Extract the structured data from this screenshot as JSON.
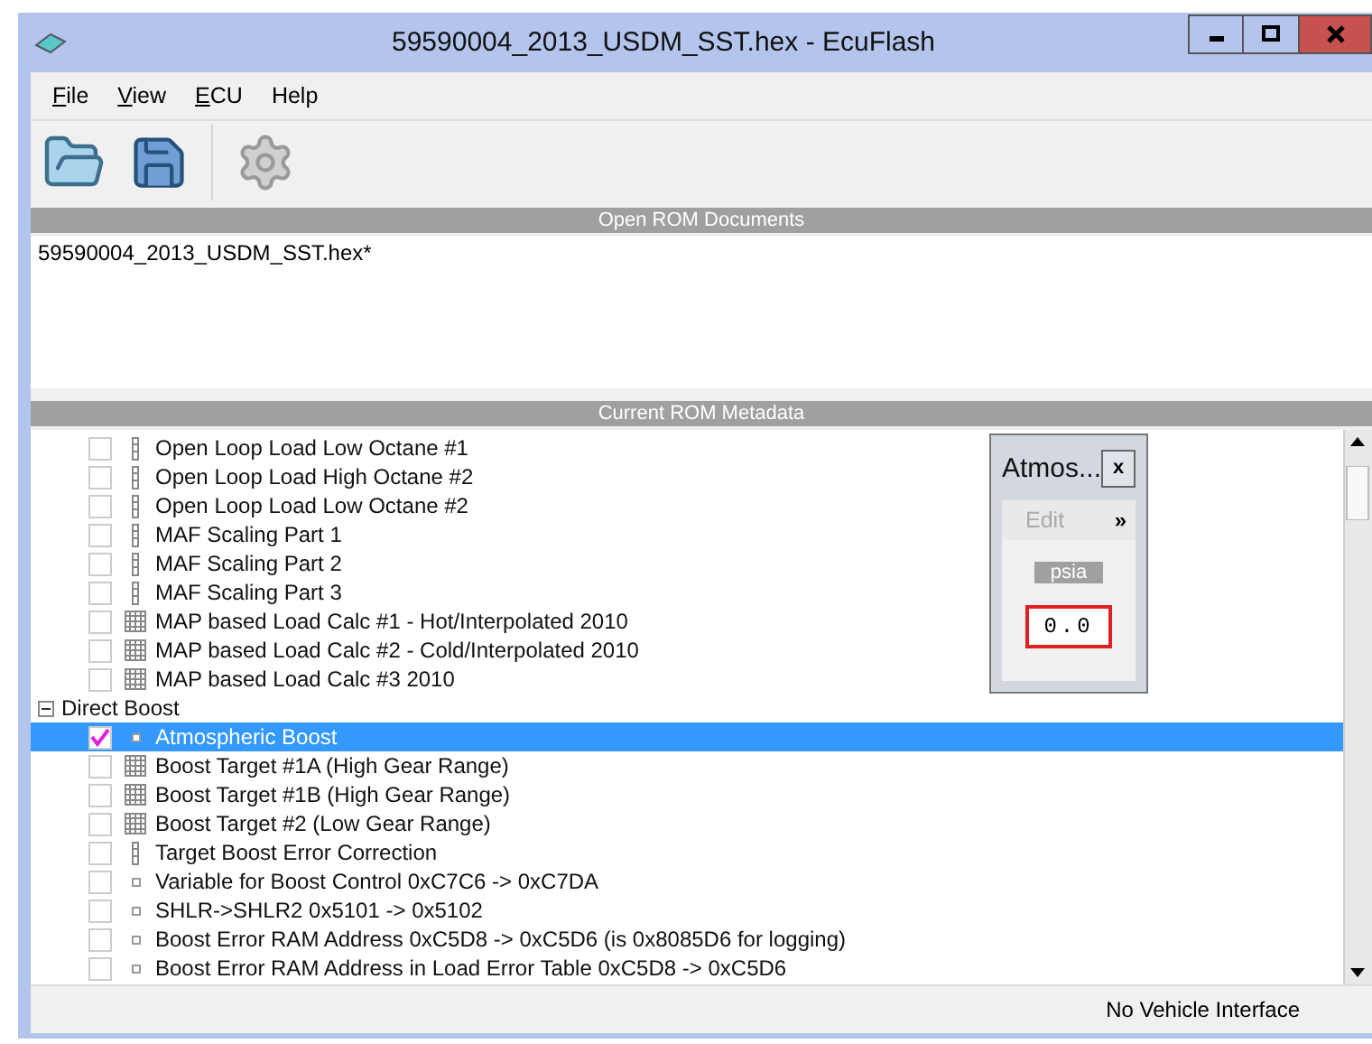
{
  "window": {
    "title": "59590004_2013_USDM_SST.hex - EcuFlash"
  },
  "menu": [
    {
      "label": "File",
      "mnemonic": true
    },
    {
      "label": "View",
      "mnemonic": true
    },
    {
      "label": "ECU",
      "mnemonic": true
    },
    {
      "label": "Help",
      "mnemonic": false
    }
  ],
  "toolbar": [
    {
      "kind": "open"
    },
    {
      "kind": "save"
    },
    {
      "kind": "settings",
      "disabled": true
    }
  ],
  "open_documents": {
    "header": "Open ROM Documents",
    "items": [
      "59590004_2013_USDM_SST.hex*"
    ]
  },
  "metadata": {
    "header": "Current ROM Metadata",
    "tree": [
      {
        "kind": "continued",
        "children": [
          {
            "label": "Open Loop Load Low Octane #1",
            "kind": "column",
            "checked": false,
            "selected": false
          },
          {
            "label": "Open Loop Load High Octane #2",
            "kind": "column",
            "checked": false,
            "selected": false
          },
          {
            "label": "Open Loop Load Low Octane #2",
            "kind": "column",
            "checked": false,
            "selected": false
          },
          {
            "label": "MAF Scaling Part 1",
            "kind": "column",
            "checked": false,
            "selected": false
          },
          {
            "label": "MAF Scaling Part 2",
            "kind": "column",
            "checked": false,
            "selected": false
          },
          {
            "label": "MAF Scaling Part 3",
            "kind": "column",
            "checked": false,
            "selected": false
          },
          {
            "label": "MAP based Load Calc #1 - Hot/Interpolated 2010",
            "kind": "table",
            "checked": false,
            "selected": false
          },
          {
            "label": "MAP based Load Calc #2 - Cold/Interpolated 2010",
            "kind": "table",
            "checked": false,
            "selected": false
          },
          {
            "label": "MAP based Load Calc #3 2010",
            "kind": "table",
            "checked": false,
            "selected": false
          }
        ]
      },
      {
        "kind": "group",
        "label": "Direct Boost",
        "expanded": true,
        "children": [
          {
            "label": "Atmospheric Boost",
            "kind": "scalar",
            "checked": true,
            "selected": true
          },
          {
            "label": "Boost Target #1A (High Gear Range)",
            "kind": "table",
            "checked": false,
            "selected": false
          },
          {
            "label": "Boost Target #1B (High Gear Range)",
            "kind": "table",
            "checked": false,
            "selected": false
          },
          {
            "label": "Boost Target #2 (Low Gear Range)",
            "kind": "table",
            "checked": false,
            "selected": false
          },
          {
            "label": "Target Boost Error Correction",
            "kind": "column",
            "checked": false,
            "selected": false
          },
          {
            "label": "Variable for Boost Control 0xC7C6 -> 0xC7DA",
            "kind": "scalar",
            "checked": false,
            "selected": false
          },
          {
            "label": "SHLR->SHLR2 0x5101 -> 0x5102",
            "kind": "scalar",
            "checked": false,
            "selected": false
          },
          {
            "label": "Boost Error RAM Address 0xC5D8 -> 0xC5D6 (is 0x8085D6 for logging)",
            "kind": "scalar",
            "checked": false,
            "selected": false
          },
          {
            "label": "Boost Error RAM Address in Load Error Table 0xC5D8 -> 0xC5D6",
            "kind": "scalar",
            "checked": false,
            "selected": false
          }
        ]
      }
    ]
  },
  "table_window": {
    "title": "Atmos...",
    "close": "x",
    "menu": {
      "label": "Edit",
      "disabled": true
    },
    "more": "»",
    "unit": "psia",
    "cell": {
      "value": "0.0",
      "selected": true
    }
  },
  "status_bar": "No Vehicle Interface"
}
